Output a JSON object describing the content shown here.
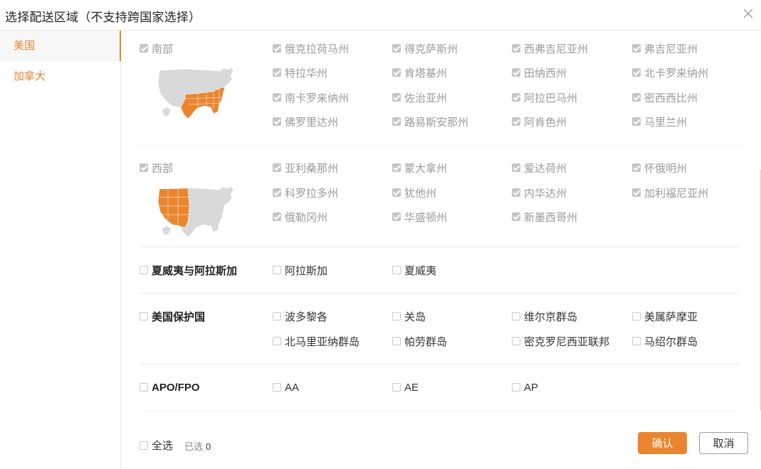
{
  "dialog": {
    "title": "选择配送区域（不支持跨国家选择）"
  },
  "sidebar": {
    "items": [
      {
        "label": "美国",
        "active": true
      },
      {
        "label": "加拿大",
        "active": false
      }
    ]
  },
  "regions": [
    {
      "name": "南部",
      "checked": true,
      "disabled": true,
      "map_highlight": "south",
      "states": [
        "俄克拉荷马州",
        "得克萨斯州",
        "西弗吉尼亚州",
        "弗吉尼亚州",
        "特拉华州",
        "肯塔基州",
        "田纳西州",
        "北卡罗来纳州",
        "南卡罗来纳州",
        "佐治亚州",
        "阿拉巴马州",
        "密西西比州",
        "佛罗里达州",
        "路易斯安那州",
        "阿肯色州",
        "马里兰州"
      ]
    },
    {
      "name": "西部",
      "checked": true,
      "disabled": true,
      "map_highlight": "west",
      "states": [
        "亚利桑那州",
        "蒙大拿州",
        "爱达荷州",
        "怀俄明州",
        "科罗拉多州",
        "犹他州",
        "内华达州",
        "加利福尼亚州",
        "俄勒冈州",
        "华盛顿州",
        "新墨西哥州"
      ]
    },
    {
      "name": "夏威夷与阿拉斯加",
      "checked": false,
      "disabled": false,
      "states": [
        "阿拉斯加",
        "夏威夷"
      ]
    },
    {
      "name": "美国保护国",
      "checked": false,
      "disabled": false,
      "states": [
        "波多黎各",
        "关岛",
        "维尔京群岛",
        "美属萨摩亚",
        "北马里亚纳群岛",
        "帕劳群岛",
        "密克罗尼西亚联邦",
        "马绍尔群岛"
      ]
    },
    {
      "name": "APO/FPO",
      "checked": false,
      "disabled": false,
      "states": [
        "AA",
        "AE",
        "AP"
      ]
    }
  ],
  "footer": {
    "select_all": "全选",
    "selected_label": "已选",
    "selected_count": "0",
    "confirm": "确认",
    "cancel": "取消"
  },
  "colors": {
    "accent": "#e8852e",
    "map_base": "#d9d9d9",
    "disabled_text": "#9a9a9a"
  }
}
